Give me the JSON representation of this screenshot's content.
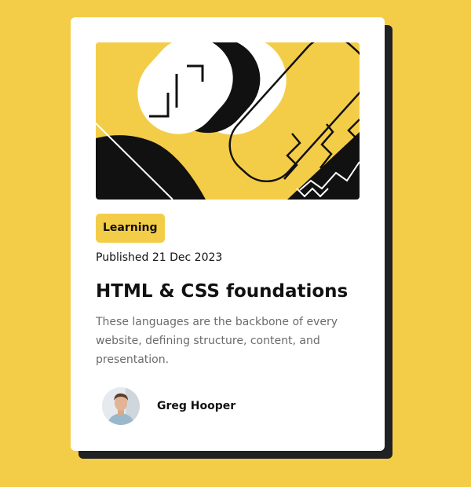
{
  "card": {
    "badge": "Learning",
    "published": "Published 21 Dec 2023",
    "title": "HTML & CSS foundations",
    "description": "These languages are the backbone of every website, defining structure, content, and presentation.",
    "author": {
      "name": "Greg Hooper"
    }
  },
  "colors": {
    "background": "#f4cd48",
    "card": "#ffffff",
    "shadow": "#1f2123",
    "text": "#111111",
    "muted_text": "#6b6b6b"
  },
  "icons": {
    "hero": "abstract-illustration",
    "avatar": "user-photo"
  }
}
